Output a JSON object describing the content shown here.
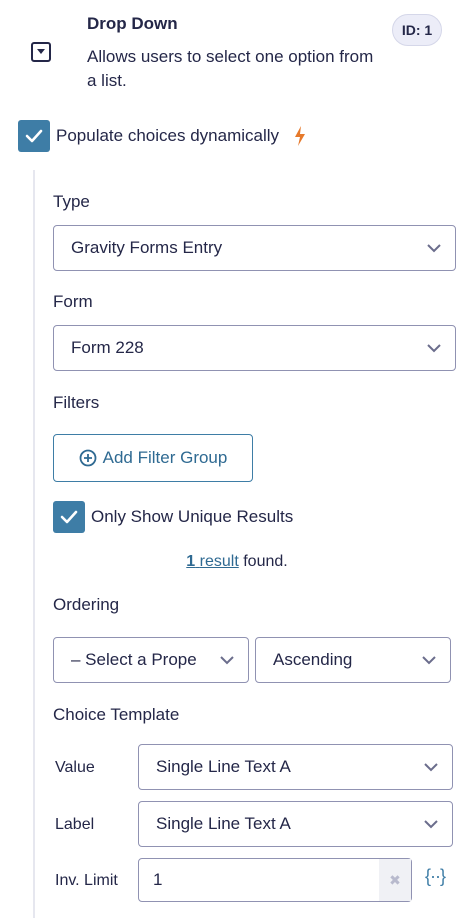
{
  "field": {
    "title": "Drop Down",
    "description": "Allows users to select one option from a list.",
    "id_badge": "ID: 1",
    "icon": "dropdown-field-icon"
  },
  "populate": {
    "label": "Populate choices dynamically",
    "checked": true,
    "lightning_icon": "lightning-icon"
  },
  "type": {
    "label": "Type",
    "value": "Gravity Forms Entry"
  },
  "form": {
    "label": "Form",
    "value": "Form 228"
  },
  "filters": {
    "label": "Filters",
    "add_button": "Add Filter Group"
  },
  "unique": {
    "label": "Only Show Unique Results",
    "checked": true
  },
  "results": {
    "count": "1",
    "link_word": "result",
    "suffix": "found."
  },
  "ordering": {
    "label": "Ordering",
    "property": "– Select a Prope",
    "direction": "Ascending"
  },
  "choice_template": {
    "label": "Choice Template",
    "value_label": "Value",
    "value_select": "Single Line Text A",
    "label_label": "Label",
    "label_select": "Single Line Text A",
    "limit_label": "Inv. Limit",
    "limit_value": "1",
    "clear_symbol": "✖",
    "merge_tag_symbol": "{··}"
  },
  "colors": {
    "accent": "#3e7da6",
    "text": "#242748",
    "border": "#9092b2",
    "lightning": "#e6792b"
  }
}
